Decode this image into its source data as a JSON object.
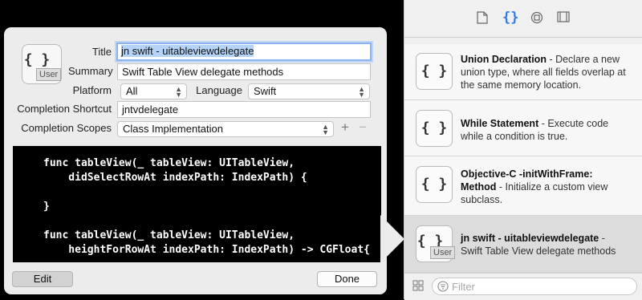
{
  "editor": {
    "title_label": "Title",
    "title_value": "jn swift - uitableviewdelegate",
    "summary_label": "Summary",
    "summary_value": "Swift Table View delegate methods",
    "platform_label": "Platform",
    "platform_value": "All",
    "language_label": "Language",
    "language_value": "Swift",
    "shortcut_label": "Completion Shortcut",
    "shortcut_value": "jntvdelegate",
    "scopes_label": "Completion Scopes",
    "scopes_value": "Class Implementation",
    "icon_glyph": "{ }",
    "user_badge": "User",
    "code": "func tableView(_ tableView: UITableView,\n    didSelectRowAt indexPath: IndexPath) {\n\n}\n\nfunc tableView(_ tableView: UITableView,\n    heightForRowAt indexPath: IndexPath) -> CGFloat{\n\n}",
    "edit_label": "Edit",
    "done_label": "Done",
    "add_symbol": "+",
    "remove_symbol": "−"
  },
  "library": {
    "items": [
      {
        "title": "Union Declaration",
        "desc": " - Declare a new union type, where all fields overlap at the same memory location.",
        "user": false
      },
      {
        "title": "While Statement",
        "desc": " - Execute code while a condition is true.",
        "user": false
      },
      {
        "title": "Objective-C -initWithFrame: Method",
        "desc": " - Initialize a custom view subclass.",
        "user": false
      },
      {
        "title": "jn swift - uitableviewdelegate",
        "desc": " - Swift Table View delegate methods",
        "user": true
      }
    ],
    "icon_glyph": "{ }",
    "user_badge": "User",
    "filter_placeholder": "Filter"
  }
}
